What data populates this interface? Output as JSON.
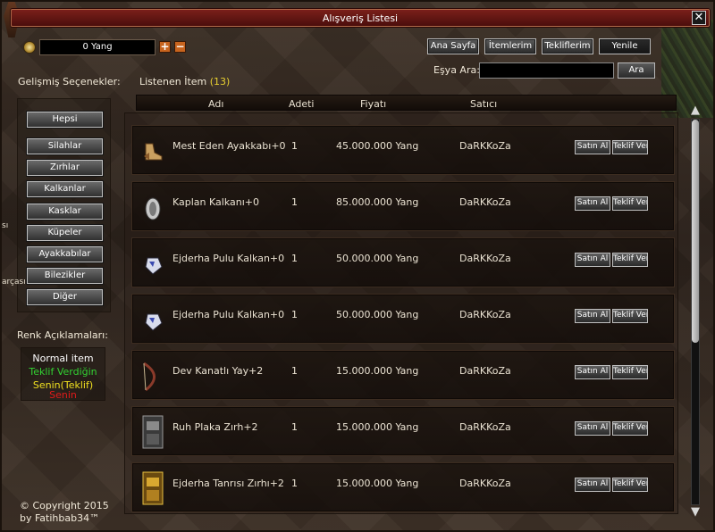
{
  "window": {
    "title": "Alışveriş Listesi"
  },
  "wallet": {
    "yang": "0 Yang",
    "plus_label": "+",
    "minus_label": "−"
  },
  "top_buttons": [
    "Ana Sayfa",
    "İtemlerim",
    "Tekliflerim",
    "Yenile"
  ],
  "search": {
    "label": "Eşya Ara:",
    "value": "",
    "button": "Ara"
  },
  "advanced": {
    "label": "Gelişmiş Seçenekler:",
    "categories": [
      "Hepsi",
      "Silahlar",
      "Zırhlar",
      "Kalkanlar",
      "Kasklar",
      "Küpeler",
      "Ayakkabılar",
      "Bilezikler",
      "Diğer"
    ]
  },
  "listing": {
    "label": "Listenen İtem",
    "count": "(13)"
  },
  "table": {
    "headers": [
      "Adı",
      "Adeti",
      "Fiyatı",
      "Satıcı"
    ],
    "buy_label": "Satın Al",
    "offer_label": "Teklif Ver",
    "rows": [
      {
        "icon": "boots-icon",
        "name": "Mest Eden Ayakkabı+0",
        "qty": "1",
        "price": "45.000.000 Yang",
        "seller": "DaRKKoZa"
      },
      {
        "icon": "shield-icon",
        "name": "Kaplan Kalkanı+0",
        "qty": "1",
        "price": "85.000.000 Yang",
        "seller": "DaRKKoZa"
      },
      {
        "icon": "dragon-shield-icon",
        "name": "Ejderha Pulu Kalkan+0",
        "qty": "1",
        "price": "50.000.000 Yang",
        "seller": "DaRKKoZa"
      },
      {
        "icon": "dragon-shield-icon",
        "name": "Ejderha Pulu Kalkan+0",
        "qty": "1",
        "price": "50.000.000 Yang",
        "seller": "DaRKKoZa"
      },
      {
        "icon": "bow-icon",
        "name": "Dev Kanatlı Yay+2",
        "qty": "1",
        "price": "15.000.000 Yang",
        "seller": "DaRKKoZa"
      },
      {
        "icon": "plate-armor-icon",
        "name": "Ruh Plaka Zırh+2",
        "qty": "1",
        "price": "15.000.000 Yang",
        "seller": "DaRKKoZa"
      },
      {
        "icon": "gold-armor-icon",
        "name": "Ejderha Tanrısı Zırhı+2",
        "qty": "1",
        "price": "15.000.000 Yang",
        "seller": "DaRKKoZa"
      }
    ]
  },
  "legend": {
    "label": "Renk Açıklamaları:",
    "items": [
      {
        "text": "Normal item",
        "color": "#ffffff"
      },
      {
        "text": "Teklif Verdiğin",
        "color": "#32d232"
      },
      {
        "text": "Senin(Teklif)",
        "color": "#f0e020"
      },
      {
        "text": "Senin",
        "color": "#e01a1a"
      }
    ]
  },
  "edge_texts": [
    "sı",
    "arçası"
  ],
  "copyright": {
    "line1": "© Copyright 2015",
    "line2": "by Fatihbab34™"
  },
  "colors": {
    "title_bar": "#6a1714",
    "count": "#e8d030"
  }
}
